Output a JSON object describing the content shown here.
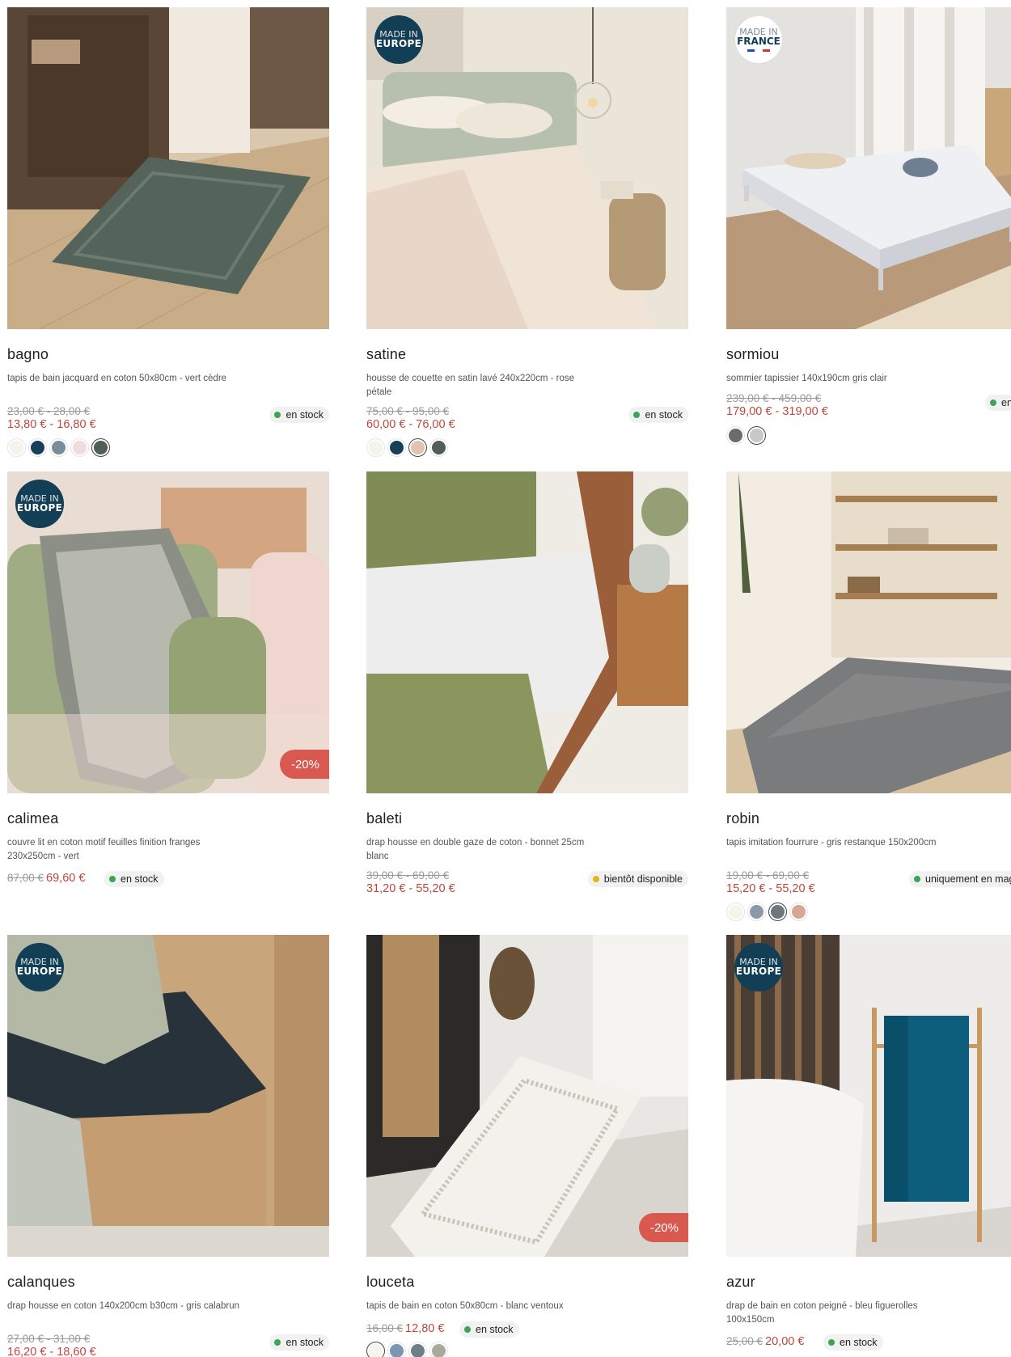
{
  "badges": {
    "europe_l1": "MADE IN",
    "europe_l2": "EUROPE",
    "france_l1": "MADE IN",
    "france_l2": "FRANCE"
  },
  "products": [
    {
      "name": "bagno",
      "desc": "tapis de bain jacquard en coton 50x80cm - vert cèdre",
      "old_price": "23,00 € - 28,00 €",
      "new_price": "13,80 € - 16,80 €",
      "stock": "en stock",
      "stock_color": "#3aa655",
      "swatches": [
        "#f6f3ea",
        "#173f56",
        "#7b8c96",
        "#f2d9db",
        "#4f5f55"
      ],
      "selected": 4
    },
    {
      "name": "satine",
      "desc": "housse de couette en satin lavé 240x220cm - rose pétale",
      "old_price": "75,00 € - 95,00 €",
      "new_price": "60,00 € - 76,00 €",
      "stock": "en stock",
      "stock_color": "#3aa655",
      "swatches": [
        "#f6f3ea",
        "#173f56",
        "#e2c3b0",
        "#4f5f55"
      ],
      "selected": 2
    },
    {
      "name": "sormiou",
      "desc": "sommier tapissier 140x190cm gris clair",
      "old_price": "239,00 € - 459,00 €",
      "new_price": "179,00 € - 319,00 €",
      "stock": "en stock",
      "stock_color": "#3aa655",
      "swatches": [
        "#6b6b6b",
        "#c8c8c8"
      ],
      "selected": 1
    },
    {
      "name": "calimea",
      "desc": "couvre lit en coton motif feuilles finition franges 230x250cm - vert",
      "old_price": "87,00 €",
      "new_price": "69,60 €",
      "stock": "en stock",
      "stock_color": "#3aa655",
      "discount": "-20%"
    },
    {
      "name": "baleti",
      "desc": "drap housse en double gaze de coton - bonnet 25cm blanc",
      "old_price": "39,00 € - 69,00 €",
      "new_price": "31,20 € - 55,20 €",
      "stock": "bientôt disponible",
      "stock_color": "#e5b414"
    },
    {
      "name": "robin",
      "desc": "tapis imitation fourrure - gris restanque 150x200cm",
      "old_price": "19,00 € - 69,00 €",
      "new_price": "15,20 € - 55,20 €",
      "stock": "uniquement en magasin",
      "stock_color": "#3aa655",
      "swatches": [
        "#f6f3ea",
        "#8a9aa6",
        "#6b7880",
        "#d4a994"
      ],
      "selected": 2
    },
    {
      "name": "calanques",
      "desc": "drap housse en coton 140x200cm b30cm - gris calabrun",
      "old_price": "27,00 € - 31,00 €",
      "new_price": "16,20 € - 18,60 €",
      "stock": "en stock",
      "stock_color": "#3aa655"
    },
    {
      "name": "louceta",
      "desc": "tapis de bain en coton 50x80cm - blanc ventoux",
      "old_price": "16,00 €",
      "new_price": "12,80 €",
      "stock": "en stock",
      "stock_color": "#3aa655",
      "discount": "-20%",
      "swatches": [
        "#f6f3ea",
        "#7a96b0",
        "#6f7f86",
        "#a9ab9a"
      ],
      "selected": 0
    },
    {
      "name": "azur",
      "desc": "drap de bain en coton peigné - bleu figuerolles 100x150cm",
      "old_price": "25,00 €",
      "new_price": "20,00 €",
      "stock": "en stock",
      "stock_color": "#3aa655"
    }
  ]
}
